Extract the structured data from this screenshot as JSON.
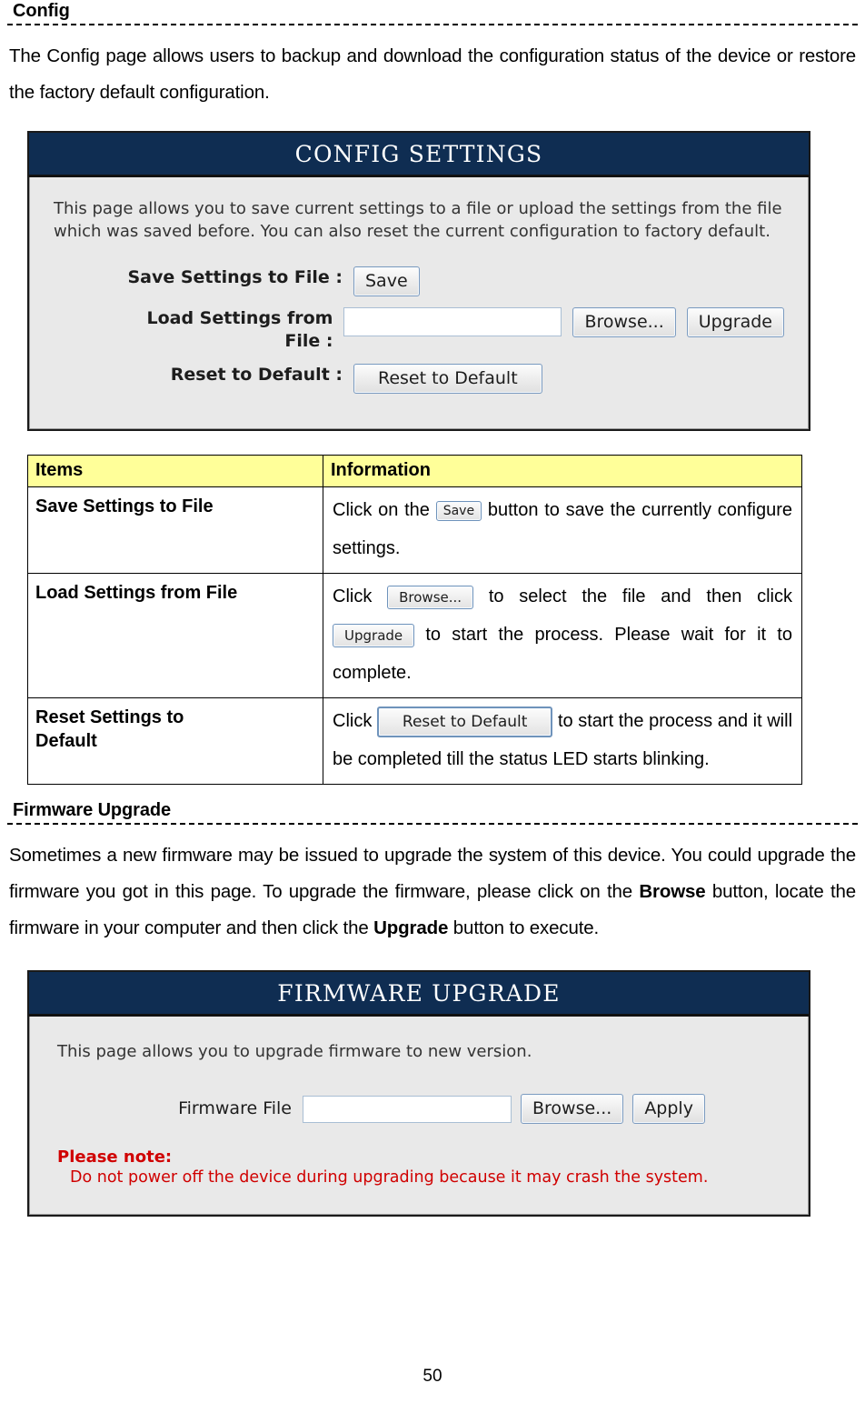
{
  "sections": {
    "config": {
      "heading": "Config",
      "paragraph": "The Config page allows users to backup and download the configuration status of the device or restore the factory default configuration."
    },
    "firmware": {
      "heading": "Firmware Upgrade",
      "paragraph_part1": "Sometimes a new firmware may be issued to upgrade the system of this device. You could upgrade the firmware you got in this page. To upgrade the firmware, please click on the ",
      "paragraph_bold1": "Browse",
      "paragraph_part2": " button, locate the firmware in your computer and then click the ",
      "paragraph_bold2": "Upgrade",
      "paragraph_part3": " button to execute."
    }
  },
  "config_screenshot": {
    "title": "CONFIG SETTINGS",
    "description": "This page allows you to save current settings to a file or upload the settings from the file which was saved before. You can also reset the current configuration to factory default.",
    "rows": [
      {
        "label": "Save Settings to File :",
        "button": "Save"
      },
      {
        "label_line1": "Load Settings from",
        "label_line2": "File :",
        "input_value": "",
        "input_placeholder": "",
        "browse_button": "Browse...",
        "upgrade_button": "Upgrade"
      },
      {
        "label": "Reset to Default :",
        "button": "Reset to Default"
      }
    ],
    "colors": {
      "titlebar": "#0f2d52",
      "body": "#e9e9e9",
      "border": "#1a1a1a"
    }
  },
  "info_table": {
    "headers": [
      "Items",
      "Information"
    ],
    "rows": [
      {
        "item": "Save Settings to File",
        "info_pre": "Click on the ",
        "info_btn1": "Save",
        "info_mid": " button to save the ",
        "info_post": "currently configure settings."
      },
      {
        "item": "Load Settings from File",
        "info_pre": "Click ",
        "info_btn1": "Browse...",
        "info_mid": " to select the file and then ",
        "info_pre2": "click ",
        "info_btn2": "Upgrade",
        "info_mid2": " to start the process. Please ",
        "info_post": "wait for it to complete."
      },
      {
        "item_line1": "Reset Settings to",
        "item_line2": "Default",
        "info_pre": "Click ",
        "info_btn1": "Reset to Default",
        "info_mid": " to start the ",
        "info_mid2": "process and it will be completed till the ",
        "info_post": "status LED starts blinking."
      }
    ],
    "colors": {
      "header_bg": "#ffff99",
      "border": "#000000"
    }
  },
  "firmware_screenshot": {
    "title": "FIRMWARE UPGRADE",
    "description": "This page allows you to upgrade firmware to new version.",
    "field_label": "Firmware File",
    "input_value": "",
    "browse_button": "Browse...",
    "apply_button": "Apply",
    "note_title": "Please note:",
    "note_text": "Do not power off the device during upgrading because it may crash the system.",
    "colors": {
      "titlebar": "#0f2d52",
      "note": "#d00000"
    }
  },
  "footer": {
    "page_number": "50"
  }
}
